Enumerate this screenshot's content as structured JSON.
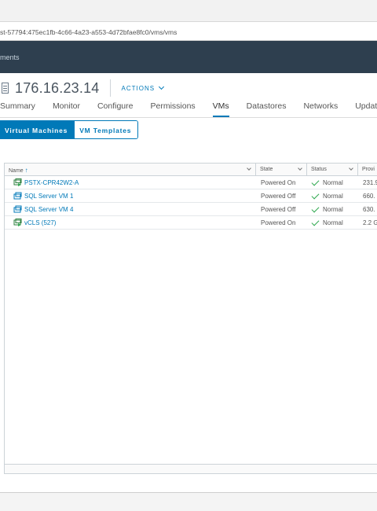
{
  "address": {
    "url": "st-57794:475ec1fb-4c66-4a23-a553-4d72bfae8fc0/vms/vms"
  },
  "appbar": {
    "title": "ments"
  },
  "host": {
    "name": "176.16.23.14",
    "actions_label": "ACTIONS"
  },
  "tabs": [
    {
      "label": "Summary",
      "active": false
    },
    {
      "label": "Monitor",
      "active": false
    },
    {
      "label": "Configure",
      "active": false
    },
    {
      "label": "Permissions",
      "active": false
    },
    {
      "label": "VMs",
      "active": true
    },
    {
      "label": "Datastores",
      "active": false
    },
    {
      "label": "Networks",
      "active": false
    },
    {
      "label": "Updates",
      "active": false
    }
  ],
  "toggle": {
    "virtual_machines": "Virtual Machines",
    "vm_templates": "VM Templates",
    "selected": "Virtual Machines"
  },
  "table": {
    "columns": [
      {
        "label": "Name",
        "sorted": "ascending",
        "sort_icon": "up-arrow"
      },
      {
        "label": "State"
      },
      {
        "label": "Status"
      },
      {
        "label": "Provi"
      }
    ],
    "rows": [
      {
        "name": "PSTX-CPR42W2-A",
        "icon": "vm-powered-on-icon",
        "state": "Powered On",
        "status": "Normal",
        "provisioned": "231.9"
      },
      {
        "name": "SQL Server VM 1",
        "icon": "vm-icon",
        "state": "Powered Off",
        "status": "Normal",
        "provisioned": "660."
      },
      {
        "name": "SQL Server VM 4",
        "icon": "vm-icon",
        "state": "Powered Off",
        "status": "Normal",
        "provisioned": "630."
      },
      {
        "name": "vCLS (527)",
        "icon": "vm-powered-on-icon",
        "state": "Powered On",
        "status": "Normal",
        "provisioned": "2.2 G"
      }
    ]
  },
  "colors": {
    "accent": "#0079b8",
    "header": "#2e3f4f",
    "ok": "#2fa84f"
  }
}
